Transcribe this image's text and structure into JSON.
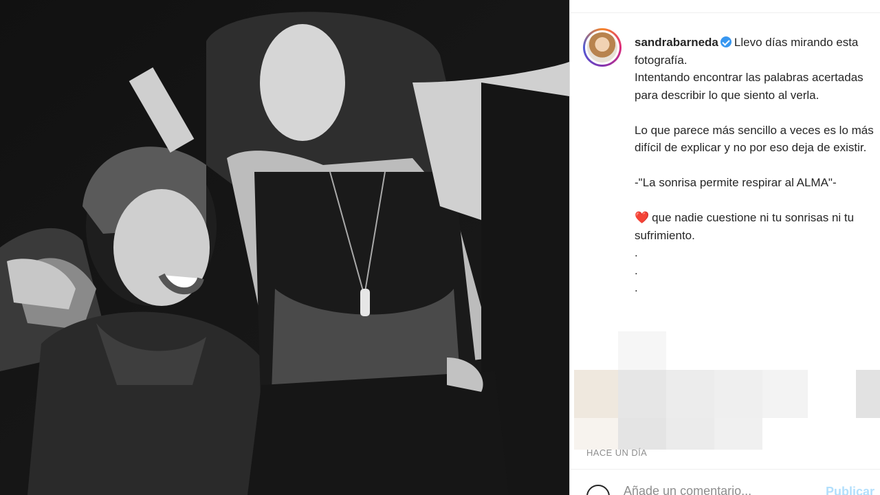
{
  "post": {
    "photo_alt": "black and white photograph",
    "username": "sandrabarneda",
    "verified_icon": "verified-badge-icon",
    "caption_first_line": "Llevo días mirando esta fotografía.",
    "caption_lines": [
      "Intentando encontrar las palabras acertadas para describir lo que siento al verla.",
      "Lo que parece más sencillo a veces es lo más difícil de explicar y no por eso deja de existir.",
      "-\"La sonrisa permite respirar al ALMA\"-"
    ],
    "heart_emoji": "❤️",
    "heart_line": "que nadie cuestione ni tu sonrisas ni tu sufrimiento.",
    "dots": [
      ".",
      ".",
      "."
    ],
    "timestamp": "HACE UN DÍA"
  },
  "comment": {
    "placeholder": "Añade un comentario...",
    "publish_label": "Publicar",
    "emoji_icon": "smiley-icon"
  },
  "colors": {
    "link_blue": "#3897f0",
    "publish_disabled": "#b2dffc",
    "text": "#262626",
    "muted": "#8e8e8e"
  }
}
